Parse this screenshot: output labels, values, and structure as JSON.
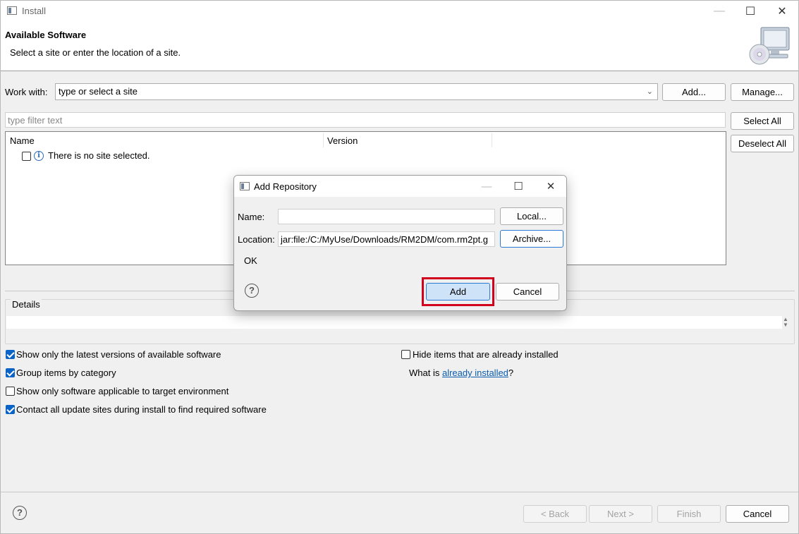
{
  "window": {
    "title": "Install",
    "header_title": "Available Software",
    "header_subtitle": "Select a site or enter the location of a site."
  },
  "work_with": {
    "label": "Work with:",
    "value": "type or select a site",
    "add_label": "Add...",
    "manage_label": "Manage..."
  },
  "filter": {
    "placeholder": "type filter text",
    "select_all_label": "Select All",
    "deselect_all_label": "Deselect All"
  },
  "tree": {
    "columns": [
      "Name",
      "Version"
    ],
    "rows": [
      {
        "label": "There is no site selected.",
        "checked": false,
        "icon": "info-icon"
      }
    ]
  },
  "details": {
    "label": "Details"
  },
  "options": {
    "show_latest": {
      "label": "Show only the latest versions of available software",
      "checked": true
    },
    "group_by_category": {
      "label": "Group items by category",
      "checked": true
    },
    "show_applicable": {
      "label": "Show only software applicable to target environment",
      "checked": false
    },
    "contact_sites": {
      "label": "Contact all update sites during install to find required software",
      "checked": true
    },
    "hide_installed": {
      "label": "Hide items that are already installed",
      "checked": false
    },
    "what_is_prefix": "What is ",
    "already_installed_link": "already installed",
    "what_is_suffix": "?"
  },
  "footer": {
    "back_label": "< Back",
    "next_label": "Next >",
    "finish_label": "Finish",
    "cancel_label": "Cancel"
  },
  "dialog": {
    "title": "Add Repository",
    "name_label": "Name:",
    "name_value": "",
    "local_label": "Local...",
    "location_label": "Location:",
    "location_value": "jar:file:/C:/MyUse/Downloads/RM2DM/com.rm2pt.g",
    "archive_label": "Archive...",
    "status_text": "OK",
    "add_label": "Add",
    "cancel_label": "Cancel"
  },
  "colors": {
    "highlight": "#d1001c",
    "link": "#0b5cad",
    "checkbox_on": "#0a64c8",
    "primary_button": "#cfe3f8"
  }
}
